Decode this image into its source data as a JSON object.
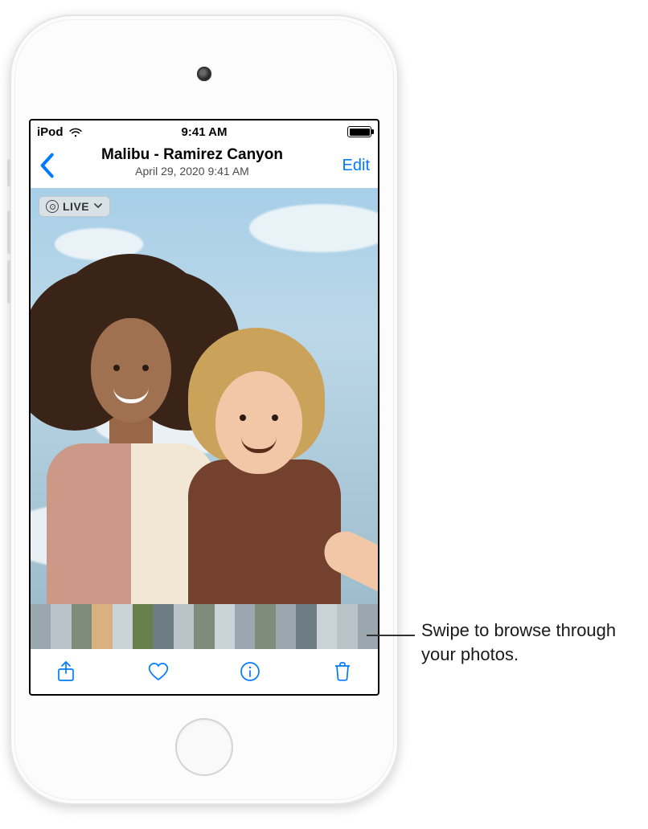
{
  "statusbar": {
    "device_label": "iPod",
    "time": "9:41 AM"
  },
  "navbar": {
    "title": "Malibu - Ramirez Canyon",
    "subtitle": "April 29, 2020  9:41 AM",
    "edit_label": "Edit"
  },
  "live_badge": {
    "label": "LIVE"
  },
  "thumbnails": {
    "count": 17
  },
  "toolbar": {
    "share": "share-icon",
    "favorite": "heart-icon",
    "info": "info-icon",
    "trash": "trash-icon"
  },
  "callout": {
    "text": "Swipe to browse through your photos."
  },
  "colors": {
    "tint": "#007aff"
  }
}
